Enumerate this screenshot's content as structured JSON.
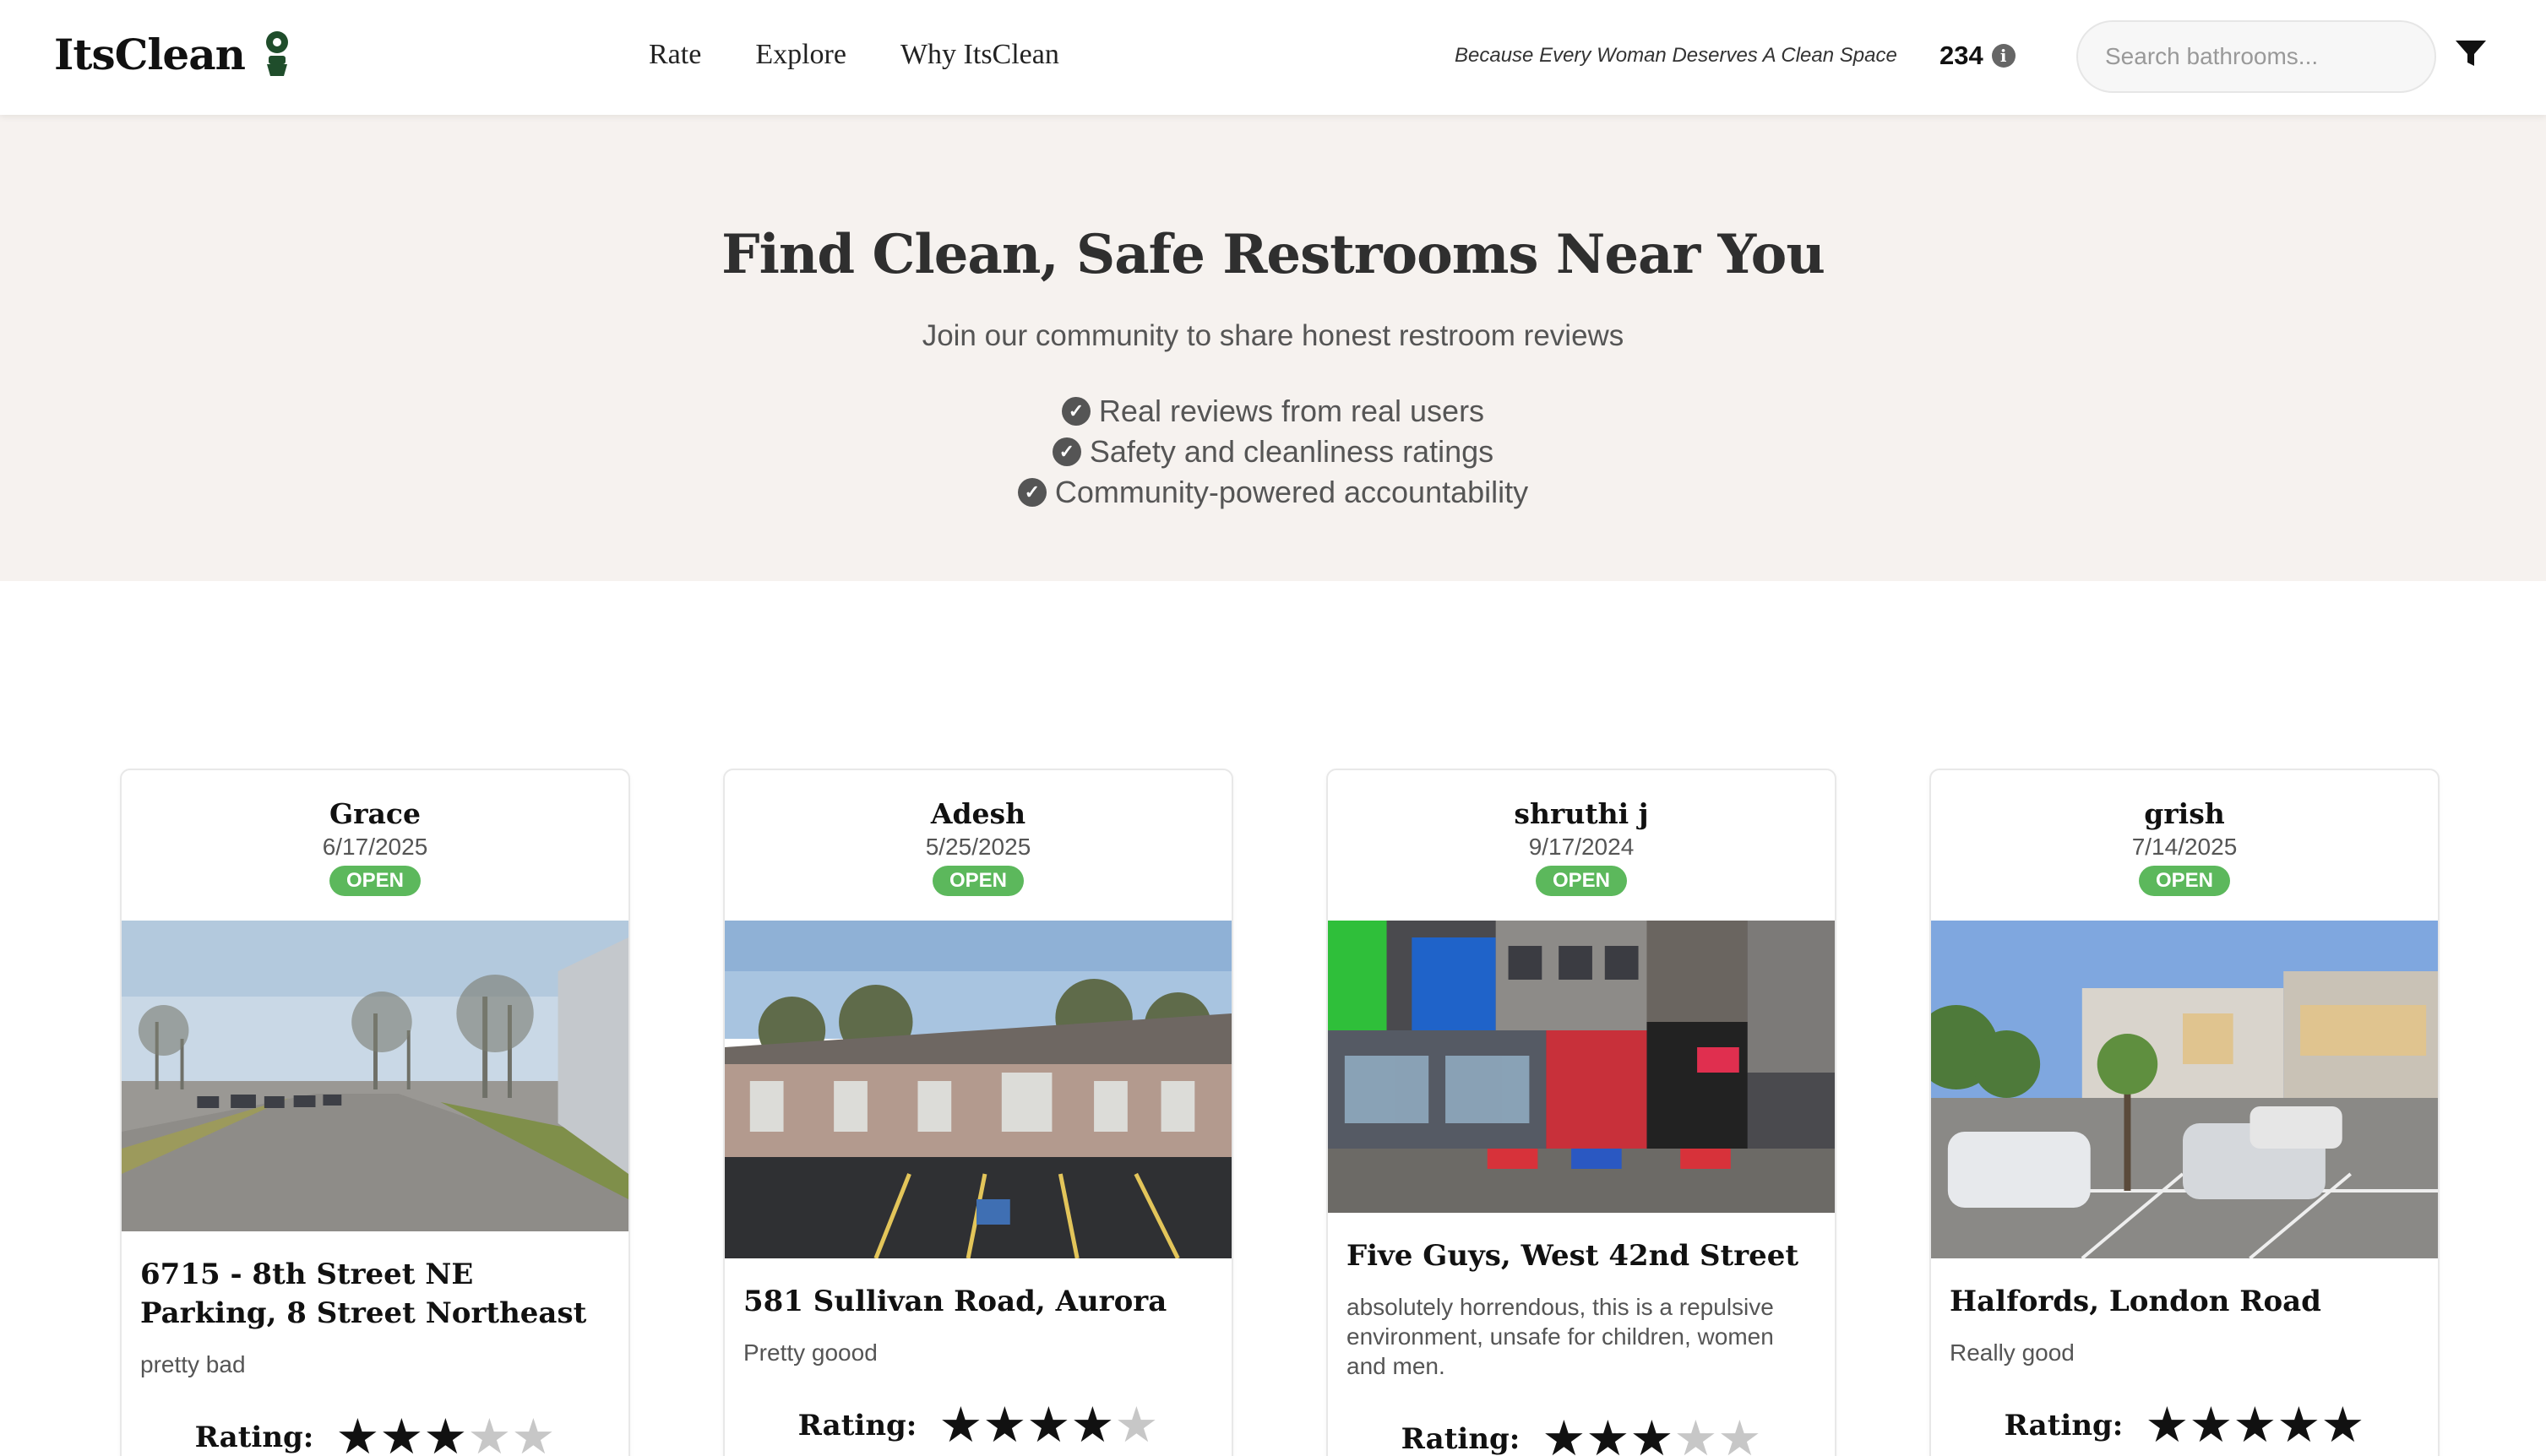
{
  "nav": {
    "brand": "ItsClean",
    "links": [
      "Rate",
      "Explore",
      "Why ItsClean"
    ],
    "tagline": "Because Every Woman Deserves A Clean Space",
    "count": "234",
    "search_placeholder": "Search bathrooms..."
  },
  "hero": {
    "title": "Find Clean, Safe Restrooms Near You",
    "subtitle": "Join our community to share honest restroom reviews",
    "features": [
      "Real reviews from real users",
      "Safety and cleanliness ratings",
      "Community-powered accountability"
    ]
  },
  "cards": [
    {
      "user": "Grace",
      "date": "6/17/2025",
      "status": "OPEN",
      "title": "6715 - 8th Street NE Parking, 8 Street Northeast",
      "desc": "pretty bad",
      "rating_label": "Rating:",
      "rating": 3
    },
    {
      "user": "Adesh",
      "date": "5/25/2025",
      "status": "OPEN",
      "title": "581 Sullivan Road, Aurora",
      "desc": "Pretty goood",
      "rating_label": "Rating:",
      "rating": 4
    },
    {
      "user": "shruthi j",
      "date": "9/17/2024",
      "status": "OPEN",
      "title": "Five Guys, West 42nd Street",
      "desc": "absolutely horrendous, this is a repulsive environment, unsafe for children, women and men.",
      "rating_label": "Rating:",
      "rating": 3
    },
    {
      "user": "grish",
      "date": "7/14/2025",
      "status": "OPEN",
      "title": "Halfords, London Road",
      "desc": "Really good",
      "rating_label": "Rating:",
      "rating": 5
    }
  ],
  "colors": {
    "badge": "#5cb85c",
    "hero_bg": "#f6f2ef",
    "brand_icon": "#1f4d2b"
  }
}
